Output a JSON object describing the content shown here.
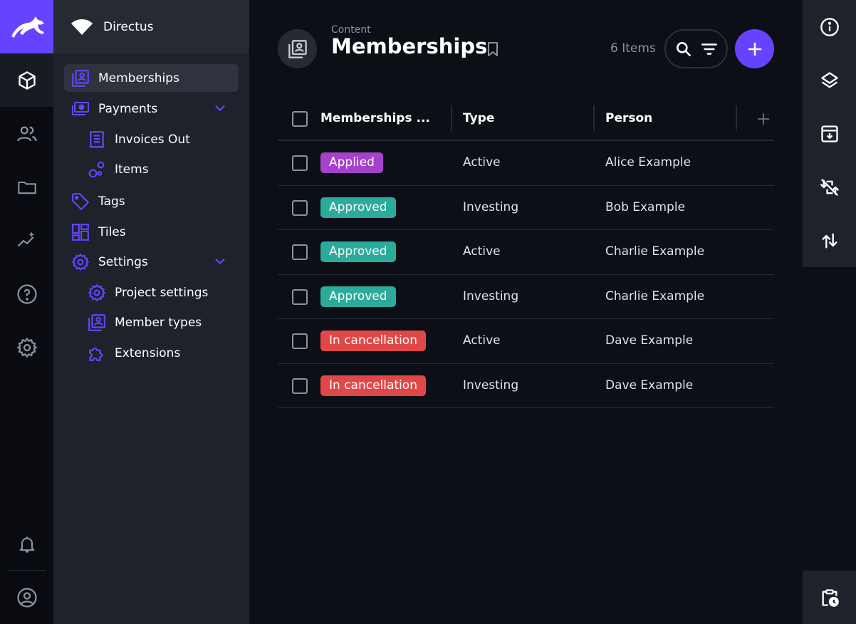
{
  "colors": {
    "accent": "#6644ff",
    "badge_applied": "#a542c9",
    "badge_approved": "#2bab9b",
    "badge_cancellation": "#e04848"
  },
  "module_bar": {
    "items": [
      {
        "icon": "content-cube-icon",
        "active": true
      },
      {
        "icon": "users-icon",
        "active": false
      },
      {
        "icon": "folder-icon",
        "active": false
      },
      {
        "icon": "insights-icon",
        "active": false
      },
      {
        "icon": "help-icon",
        "active": false
      },
      {
        "icon": "settings-gear-icon",
        "active": false
      },
      {
        "icon": "notifications-bell-icon",
        "active": false
      },
      {
        "icon": "user-account-icon",
        "active": false
      }
    ]
  },
  "navigation": {
    "project_name": "Directus",
    "items": [
      {
        "label": "Memberships",
        "icon": "memberships-icon",
        "active": true
      },
      {
        "label": "Payments",
        "icon": "payments-icon",
        "expandable": true
      },
      {
        "label": "Invoices Out",
        "icon": "invoice-icon",
        "child": true
      },
      {
        "label": "Items",
        "icon": "items-bubbles-icon",
        "child": true
      },
      {
        "label": "Tags",
        "icon": "tag-icon"
      },
      {
        "label": "Tiles",
        "icon": "tiles-icon"
      },
      {
        "label": "Settings",
        "icon": "settings-icon",
        "expandable": true
      },
      {
        "label": "Project settings",
        "icon": "project-settings-icon",
        "child": true
      },
      {
        "label": "Member types",
        "icon": "member-types-icon",
        "child": true
      },
      {
        "label": "Extensions",
        "icon": "extensions-icon",
        "child": true
      }
    ]
  },
  "header": {
    "breadcrumb": "Content",
    "title": "Memberships",
    "items_count": "6 Items"
  },
  "table": {
    "columns": [
      "Memberships ...",
      "Type",
      "Person"
    ],
    "rows": [
      {
        "status": "Applied",
        "status_kind": "applied",
        "type": "Active",
        "person": "Alice Example"
      },
      {
        "status": "Approved",
        "status_kind": "approved",
        "type": "Investing",
        "person": "Bob Example"
      },
      {
        "status": "Approved",
        "status_kind": "approved",
        "type": "Active",
        "person": "Charlie Example"
      },
      {
        "status": "Approved",
        "status_kind": "approved",
        "type": "Investing",
        "person": "Charlie Example"
      },
      {
        "status": "In cancellation",
        "status_kind": "cancellation",
        "type": "Active",
        "person": "Dave Example"
      },
      {
        "status": "In cancellation",
        "status_kind": "cancellation",
        "type": "Investing",
        "person": "Dave Example"
      }
    ]
  },
  "sidebar": {
    "items": [
      "info-icon",
      "layout-layers-icon",
      "archive-icon",
      "sync-off-icon",
      "import-export-icon",
      "revisions-clipboard-icon"
    ]
  }
}
